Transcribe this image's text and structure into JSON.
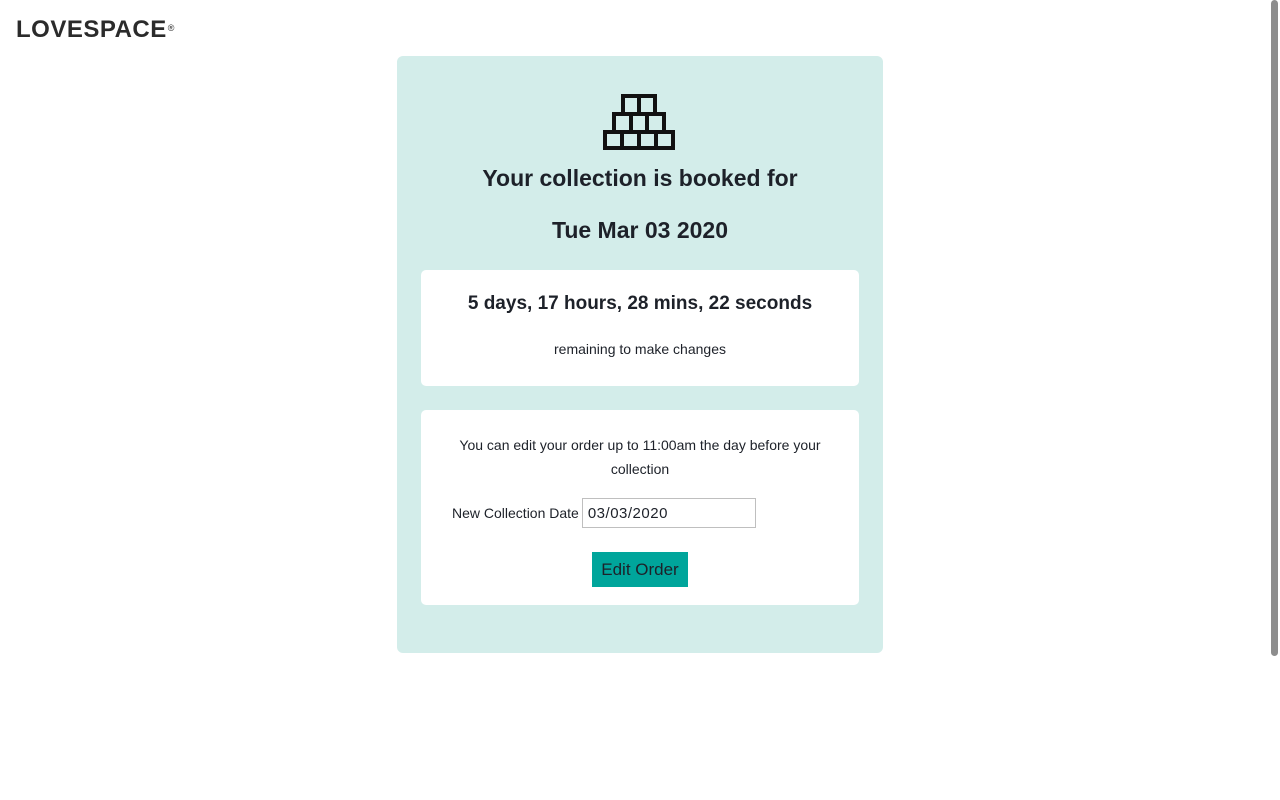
{
  "header": {
    "logo_text": "LOVESPACE",
    "logo_mark": "®"
  },
  "collection": {
    "icon": "stacked-boxes-icon",
    "heading": "Your collection is booked for",
    "date": "Tue Mar 03 2020"
  },
  "countdown": {
    "value": "5 days, 17 hours, 28 mins, 22 seconds",
    "note": "remaining to make changes"
  },
  "edit": {
    "info": "You can edit your order up to 11:00am the day before your collection",
    "date_label": "New Collection Date",
    "date_value": "03/03/2020",
    "button_label": "Edit Order"
  },
  "colors": {
    "panel_background": "#d3edea",
    "button_accent": "#00a59b"
  }
}
